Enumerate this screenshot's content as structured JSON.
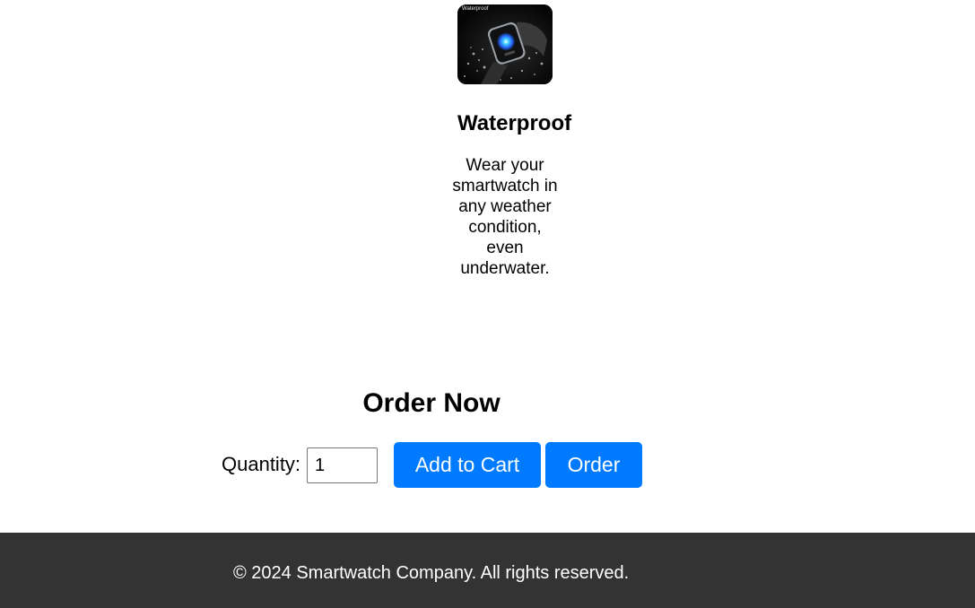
{
  "feature": {
    "image_caption": "Waterproof",
    "image_alt": "Waterproof smartwatch",
    "title": "Waterproof",
    "description": "Wear your smartwatch in any weather condition, even underwater."
  },
  "order": {
    "heading": "Order Now",
    "quantity_label": "Quantity:",
    "quantity_value": "1",
    "add_to_cart_label": "Add to Cart",
    "order_label": "Order"
  },
  "footer": {
    "copyright": "© 2024 Smartwatch Company. All rights reserved."
  },
  "colors": {
    "button_bg": "#007bff",
    "button_text": "#ffffff",
    "footer_bg": "#333333",
    "footer_text": "#ffffff"
  }
}
